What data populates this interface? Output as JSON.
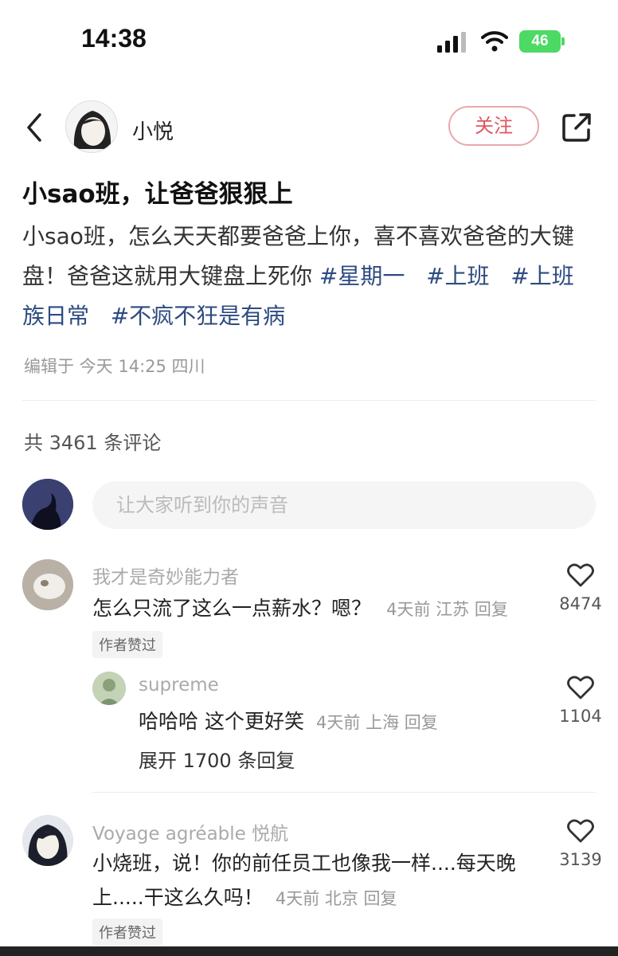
{
  "status_bar": {
    "time": "14:38",
    "battery": "46"
  },
  "author": {
    "name": "小悦",
    "follow_label": "关注"
  },
  "post": {
    "title": "小sao班，让爸爸狠狠上",
    "body_text": "小sao班，怎么天天都要爸爸上你，喜不喜欢爸爸的大键盘！爸爸这就用大键盘上死你",
    "tags": [
      "#星期一",
      "#上班",
      "#上班族日常",
      "#不疯不狂是有病"
    ],
    "meta": "编辑于 今天 14:25 四川"
  },
  "comments_header": {
    "count_text": "共 3461 条评论",
    "input_placeholder": "让大家听到你的声音"
  },
  "comments": [
    {
      "user": "我才是奇妙能力者",
      "text": "怎么只流了这么一点薪水？嗯？",
      "meta": "4天前 江苏 回复",
      "likes": "8474",
      "badge": "作者赞过",
      "replies": [
        {
          "user": "supreme",
          "text": "哈哈哈 这个更好笑",
          "meta": "4天前 上海 回复",
          "likes": "1104"
        }
      ],
      "expand": "展开 1700 条回复"
    },
    {
      "user": "Voyage agréable 悦航",
      "text": "小烧班，说！你的前任员工也像我一样....每天晚上.....干这么久吗！",
      "meta": "4天前 北京 回复",
      "likes": "3139",
      "badge": "作者赞过"
    }
  ]
}
